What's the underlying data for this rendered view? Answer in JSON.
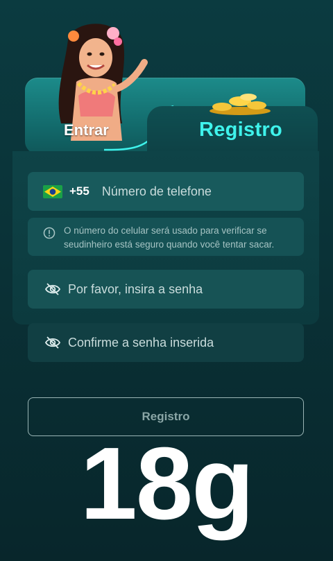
{
  "tabs": {
    "login_label": "Entrar",
    "register_label": "Registro"
  },
  "phone": {
    "country_code": "+55",
    "placeholder": "Número de telefone",
    "flag": "brazil-flag-icon"
  },
  "info": {
    "text": "O número do celular será usado para verificar se seudinheiro está seguro quando você tentar sacar.",
    "icon": "info-icon"
  },
  "password": {
    "placeholder": "Por favor, insira a senha",
    "icon": "eye-off-icon"
  },
  "confirm_password": {
    "placeholder": "Confirme a senha inserida",
    "icon": "eye-off-icon"
  },
  "submit": {
    "label": "Registro"
  },
  "overlay": {
    "text": "18g"
  },
  "colors": {
    "accent": "#3ff3ec",
    "background": "#0a3237",
    "field": "#185a5c"
  }
}
